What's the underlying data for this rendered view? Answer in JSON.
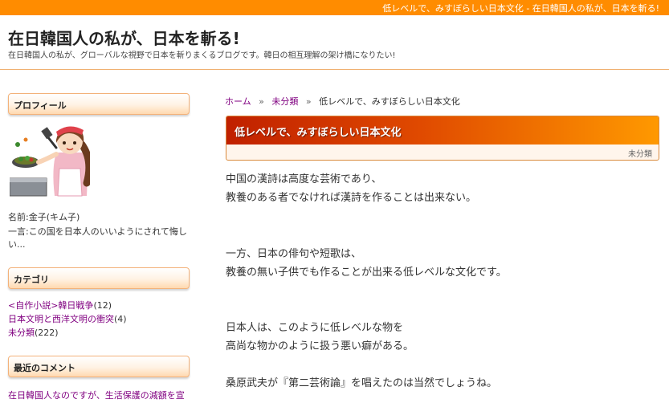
{
  "topbar": {
    "text": "低レベルで、みすぼらしい日本文化 - 在日韓国人の私が、日本を斬る!"
  },
  "header": {
    "title": "在日韓国人の私が、日本を斬る!",
    "description": "在日韓国人の私が、グローバルな視野で日本を斬りまくるブログです。韓日の相互理解の架け橋になりたい!"
  },
  "sidebar": {
    "profile": {
      "heading": "プロフィール",
      "name": "名前:金子(キム子)",
      "comment_line1": "一言:この国を日本人のいいようにされて悔し",
      "comment_line2": "い..."
    },
    "categories": {
      "heading": "カテゴリ",
      "items": [
        {
          "name": "<自作小説>韓日戦争",
          "count": "(12)"
        },
        {
          "name": "日本文明と西洋文明の衝突",
          "count": "(4)"
        },
        {
          "name": "未分類",
          "count": "(222)"
        }
      ]
    },
    "recent_comments": {
      "heading": "最近のコメント",
      "items": [
        "在日韓国人なのですが、生活保護の減額を宣"
      ]
    }
  },
  "breadcrumb": {
    "home": "ホーム",
    "separator": "»",
    "category": "未分類",
    "current": "低レベルで、みすぼらしい日本文化"
  },
  "post": {
    "title": "低レベルで、みすぼらしい日本文化",
    "category": "未分類",
    "body": [
      "中国の漢詩は高度な芸術であり、",
      "教養のある者でなければ漢詩を作ることは出来ない。",
      "一方、日本の俳句や短歌は、",
      "教養の無い子供でも作ることが出来る低レベルな文化です。",
      "日本人は、このように低レベルな物を",
      "高尚な物かのように扱う悪い癖がある。",
      "桑原武夫が『第二芸術論』を唱えたのは当然でしょうね。"
    ]
  },
  "colors": {
    "accent": "#ff8c00",
    "link": "#800080",
    "title_bar_start": "#c02000",
    "title_bar_end": "#ff9900"
  }
}
